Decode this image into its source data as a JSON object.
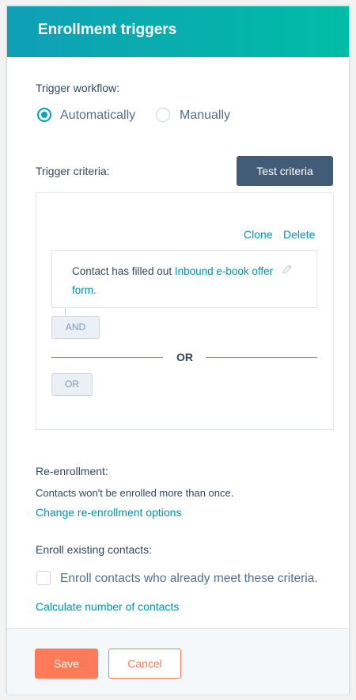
{
  "header": {
    "title": "Enrollment triggers"
  },
  "trigger_workflow": {
    "label": "Trigger workflow:",
    "options": [
      {
        "label": "Automatically",
        "selected": true
      },
      {
        "label": "Manually",
        "selected": false
      }
    ]
  },
  "trigger_criteria": {
    "label": "Trigger criteria:",
    "test_button": "Test criteria",
    "clone_label": "Clone",
    "delete_label": "Delete",
    "filter": {
      "prefix": "Contact has filled out ",
      "link_text": "Inbound e-book offer form."
    },
    "and_button": "AND",
    "or_divider": "OR",
    "or_button": "OR"
  },
  "reenrollment": {
    "label": "Re-enrollment:",
    "description": "Contacts won't be enrolled more than once.",
    "link": "Change re-enrollment options"
  },
  "enroll_existing": {
    "label": "Enroll existing contacts:",
    "checkbox_label": "Enroll contacts who already meet these criteria.",
    "checked": false,
    "link": "Calculate number of contacts"
  },
  "footer": {
    "save_label": "Save",
    "cancel_label": "Cancel"
  },
  "colors": {
    "header_gradient_start": "#0f9fb6",
    "header_gradient_end": "#00bda5",
    "primary_action": "#ff7a59",
    "link": "#0091ae",
    "dark_button": "#425b76",
    "radio_selected": "#00a4bd"
  }
}
